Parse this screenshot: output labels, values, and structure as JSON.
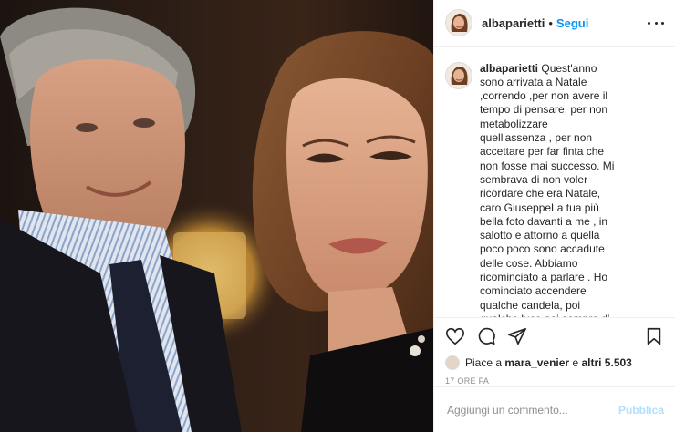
{
  "post": {
    "username": "albaparietti",
    "follow_label": "Segui",
    "more_icon": "more-horizontal-icon",
    "caption_user": "albaparietti",
    "caption_text": "Quest'anno sono arrivata a Natale ,correndo ,per non avere il tempo di pensare, per non metabolizzare quell'assenza , per non accettare per far finta che non fosse mai successo. Mi sembrava di non voler ricordare che era Natale, caro GiuseppeLa tua più bella foto davanti a me , in salotto e attorno a quella poco poco sono accadute delle cose. Abbiamo ricominciato a parlare . Ho cominciato accendere qualche candela, poi qualche luce poi sempre di più. Avevo pensato che questo Natale sarebbe stato molto triste. Ma ogni volta che sono riuscita a riparlare con te in quel dialogo infinito che c'è tra le persone che si vogliono bene. Dai sono"
  },
  "actions": {
    "like_icon": "heart-icon",
    "comment_icon": "comment-icon",
    "share_icon": "send-icon",
    "save_icon": "bookmark-icon"
  },
  "likes": {
    "prefix": "Piace a",
    "user": "mara_venier",
    "connector": "e",
    "others": "altri 5.503"
  },
  "timestamp": "17 ORE FA",
  "comment_box": {
    "placeholder": "Aggiungi un commento...",
    "publish_label": "Pubblica"
  },
  "colors": {
    "accent": "#0095f6",
    "publish_disabled": "#b2dffc",
    "text": "#262626",
    "muted": "#8e8e8e",
    "border": "#efefef"
  }
}
